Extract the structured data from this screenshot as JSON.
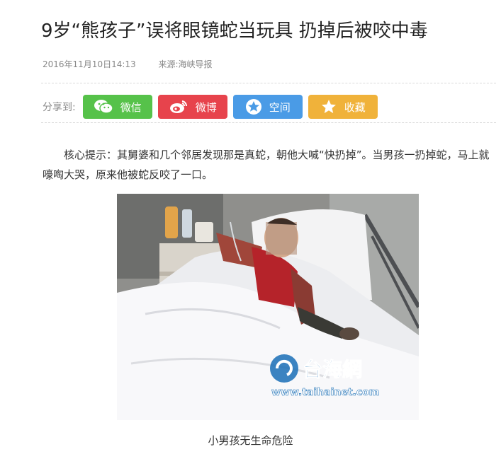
{
  "article": {
    "title": "9岁“熊孩子”误将眼镜蛇当玩具 扔掉后被咬中毒",
    "date": "2016年11月10日14:13",
    "source": "来源:海峡导报",
    "summary": "核心提示：其舅婆和几个邻居发现那是真蛇，朝他大喊“快扔掉”。当男孩一扔掉蛇，马上就嚎啕大哭，原来他被蛇反咬了一口。",
    "caption": "小男孩无生命危险"
  },
  "share": {
    "label": "分享到:",
    "buttons": [
      {
        "label": "微信",
        "icon": "wechat-icon",
        "color": "#56c24a"
      },
      {
        "label": "微博",
        "icon": "weibo-icon",
        "color": "#e7434c"
      },
      {
        "label": "空间",
        "icon": "qzone-star-icon",
        "color": "#4a9be6"
      },
      {
        "label": "收藏",
        "icon": "star-icon",
        "color": "#f0b23a"
      }
    ]
  },
  "photo": {
    "watermark_brand": "台海網",
    "watermark_url": "www.taihainet.com"
  }
}
